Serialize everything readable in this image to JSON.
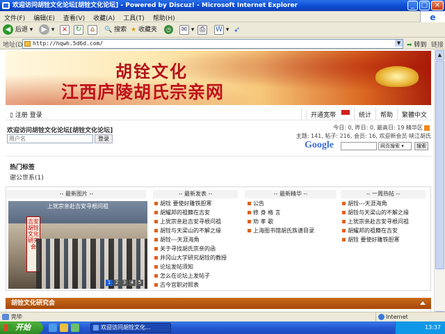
{
  "window": {
    "title": "欢迎访问胡铨文化论坛[胡铨文化论坛] - Powered by Discuz! - Microsoft Internet Explorer"
  },
  "menu": [
    "文件(F)",
    "编辑(E)",
    "查看(V)",
    "收藏(A)",
    "工具(T)",
    "帮助(H)"
  ],
  "toolbar": {
    "back": "后退",
    "search": "搜索",
    "favorites": "收藏夹"
  },
  "address": {
    "label": "地址(D)",
    "url": "http://hqwh.5d6d.com/",
    "go": "转到",
    "links": "链接"
  },
  "banner": {
    "line1": "胡铨文化",
    "line2": "江西庐陵胡氏宗亲网"
  },
  "nav": {
    "register": "注册",
    "login": "登录",
    "right": [
      "开通宽带",
      "统计",
      "帮助",
      "繁體中文"
    ]
  },
  "welcome": "欢迎访问胡铨文化论坛[胡铨文化论坛]",
  "login": {
    "username_placeholder": "用户名",
    "button": "登录"
  },
  "stats": {
    "line1": "今日: 0, 昨日: 0, 最高日: 19  精华区",
    "line2": "主题: 141, 帖子: 216, 会员: 16, 欢迎新会员 峡江胡氏"
  },
  "google": {
    "logo": "Google",
    "select": "网页搜索",
    "button": "搜索"
  },
  "hot": {
    "title": "热门标签",
    "tag": "谢公世系(1)"
  },
  "columns": [
    "-- 最新图片 --",
    "-- 最新发表 --",
    "-- 最新精华 --",
    "-- 一周热帖 --"
  ],
  "photo": {
    "caption": "上犹宗亲赴吉安寻根问祖",
    "sign": "吉安胡铨文化研究会",
    "pages": [
      "1",
      "2",
      "3",
      "4",
      "5"
    ]
  },
  "latest": [
    "胡铨 要使好雕铁胆寒",
    "胡耀邦的祖籍在吉安",
    "上犹宗亲赴吉安寻根问祖",
    "胡铨与天梁山的不解之缘",
    "胡铨---天涯海角",
    "关于寻找胡氏宗亲的函",
    "井冈山大学研究胡铨的教授",
    "论坛发帖须知",
    "怎么在论坛上发帖子",
    "古今官职对照表"
  ],
  "elite": [
    "公告",
    "修 身 格 言",
    "劝 孝 歌",
    "上海图书馆胡氏族谱目录"
  ],
  "weekly": [
    "胡铨---天涯海角",
    "胡铨与天梁山的不解之缘",
    "上犹宗亲赴吉安寻根问祖",
    "胡耀邦的祖籍在吉安",
    "胡铨 要使好雕铁胆寒"
  ],
  "section": {
    "title": "胡铨文化研究会"
  },
  "status": {
    "done": "完毕",
    "zone": "Internet"
  },
  "taskbar": {
    "start": "开始",
    "task": "欢迎访问胡铨文化...",
    "clock": "13:37"
  }
}
